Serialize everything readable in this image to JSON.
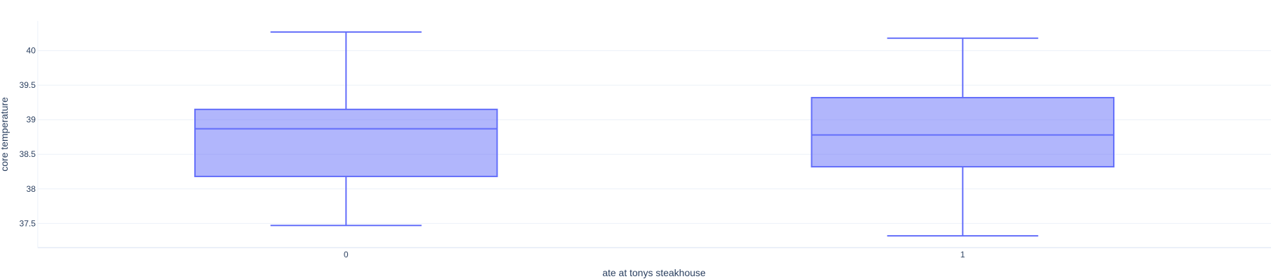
{
  "chart_data": {
    "type": "box",
    "xlabel": "ate at tonys steakhouse",
    "ylabel": "core temperature",
    "categories": [
      "0",
      "1"
    ],
    "yticks": [
      37.5,
      38,
      38.5,
      39,
      39.5,
      40
    ],
    "ytick_labels": [
      "37.5",
      "38",
      "38.5",
      "39",
      "39.5",
      "40"
    ],
    "ylim": [
      37.15,
      40.43
    ],
    "grid": true,
    "boxes": [
      {
        "category": "0",
        "min": 37.47,
        "q1": 38.18,
        "median": 38.87,
        "q3": 39.15,
        "max": 40.27
      },
      {
        "category": "1",
        "min": 37.32,
        "q1": 38.32,
        "median": 38.78,
        "q3": 39.32,
        "max": 40.18
      }
    ],
    "colors": {
      "line": "#636efa",
      "fill": "rgba(99,110,250,0.5)",
      "grid": "#ebf0f8",
      "axis": "#2a3f5f"
    }
  }
}
